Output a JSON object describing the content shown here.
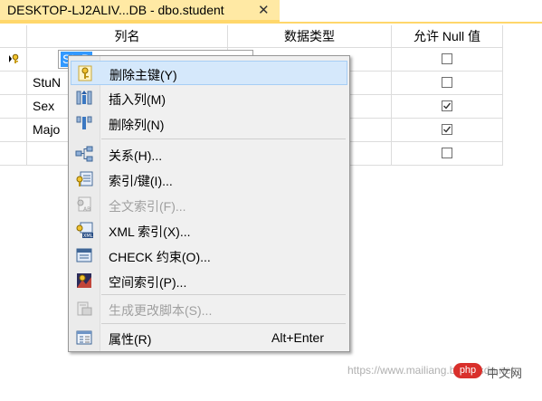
{
  "tab": {
    "title": "DESKTOP-LJ2ALIV...DB - dbo.student",
    "close": "✕"
  },
  "grid": {
    "headers": [
      "列名",
      "数据类型",
      "允许 Null 值"
    ],
    "rows": [
      {
        "name": "StuD",
        "selected": true,
        "primary_key": true,
        "allow_null": false
      },
      {
        "name": "StuN",
        "allow_null": false
      },
      {
        "name": "Sex",
        "allow_null": true
      },
      {
        "name": "Majo",
        "allow_null": true
      },
      {
        "name": "",
        "allow_null": false
      }
    ]
  },
  "menu": {
    "items": [
      {
        "label": "删除主键(Y)",
        "icon": "key-icon",
        "enabled": true,
        "highlighted": true
      },
      {
        "label": "插入列(M)",
        "icon": "insert-column-icon",
        "enabled": true
      },
      {
        "label": "删除列(N)",
        "icon": "delete-column-icon",
        "enabled": true
      },
      {
        "label": "关系(H)...",
        "icon": "relationship-icon",
        "enabled": true
      },
      {
        "label": "索引/键(I)...",
        "icon": "index-key-icon",
        "enabled": true
      },
      {
        "label": "全文索引(F)...",
        "icon": "fulltext-index-icon",
        "enabled": false
      },
      {
        "label": "XML 索引(X)...",
        "icon": "xml-index-icon",
        "enabled": true
      },
      {
        "label": "CHECK 约束(O)...",
        "icon": "check-constraint-icon",
        "enabled": true
      },
      {
        "label": "空间索引(P)...",
        "icon": "spatial-index-icon",
        "enabled": true
      },
      {
        "label": "生成更改脚本(S)...",
        "icon": "generate-script-icon",
        "enabled": false
      },
      {
        "label": "属性(R)",
        "icon": "properties-icon",
        "enabled": true,
        "shortcut": "Alt+Enter"
      }
    ]
  },
  "watermark": {
    "url": "https://www.mailiang.blog.csdn.net",
    "logo": "php",
    "site": "中文网"
  }
}
